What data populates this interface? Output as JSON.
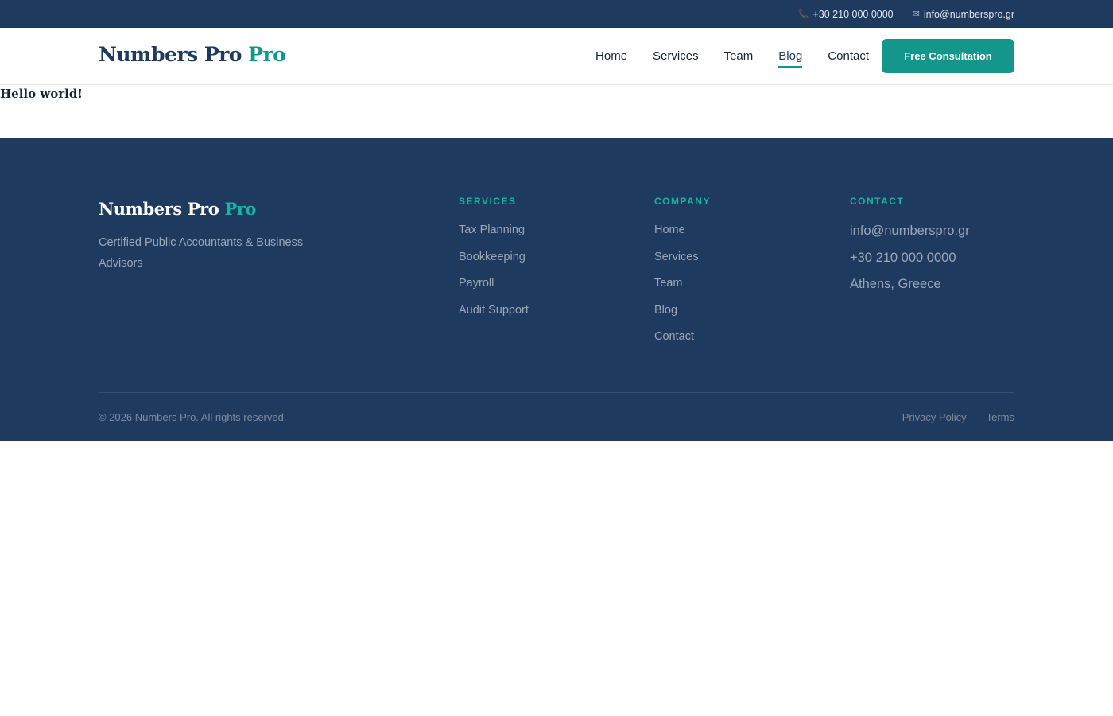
{
  "topbar": {
    "phone_icon": "phone-icon",
    "phone": "+30 210 000 0000",
    "email_icon": "mail-icon",
    "email": "info@numberspro.gr"
  },
  "header": {
    "logo_main": "Numbers Pro",
    "logo_accent": "Pro",
    "nav": [
      {
        "label": "Home"
      },
      {
        "label": "Services"
      },
      {
        "label": "Team"
      },
      {
        "label": "Blog",
        "active": true
      },
      {
        "label": "Contact"
      }
    ],
    "cta_label": "Free Consultation"
  },
  "content": {
    "text": "Hello world!"
  },
  "footer": {
    "logo_main": "Numbers Pro",
    "logo_accent": "Pro",
    "tagline": "Certified Public Accountants & Business Advisors",
    "services": {
      "heading": "SERVICES",
      "items": [
        "Tax Planning",
        "Bookkeeping",
        "Payroll",
        "Audit Support"
      ]
    },
    "company": {
      "heading": "COMPANY",
      "items": [
        "Home",
        "Services",
        "Team",
        "Blog",
        "Contact"
      ]
    },
    "contact": {
      "heading": "CONTACT",
      "items": [
        "info@numberspro.gr",
        "+30 210 000 0000",
        "Athens, Greece"
      ]
    },
    "copyright": "© 2026 Numbers Pro. All rights reserved.",
    "legal": [
      "Privacy Policy",
      "Terms"
    ]
  },
  "colors": {
    "primary_navy": "#1f3a5f",
    "accent_teal": "#14968a",
    "footer_text": "#9aa7b8"
  }
}
